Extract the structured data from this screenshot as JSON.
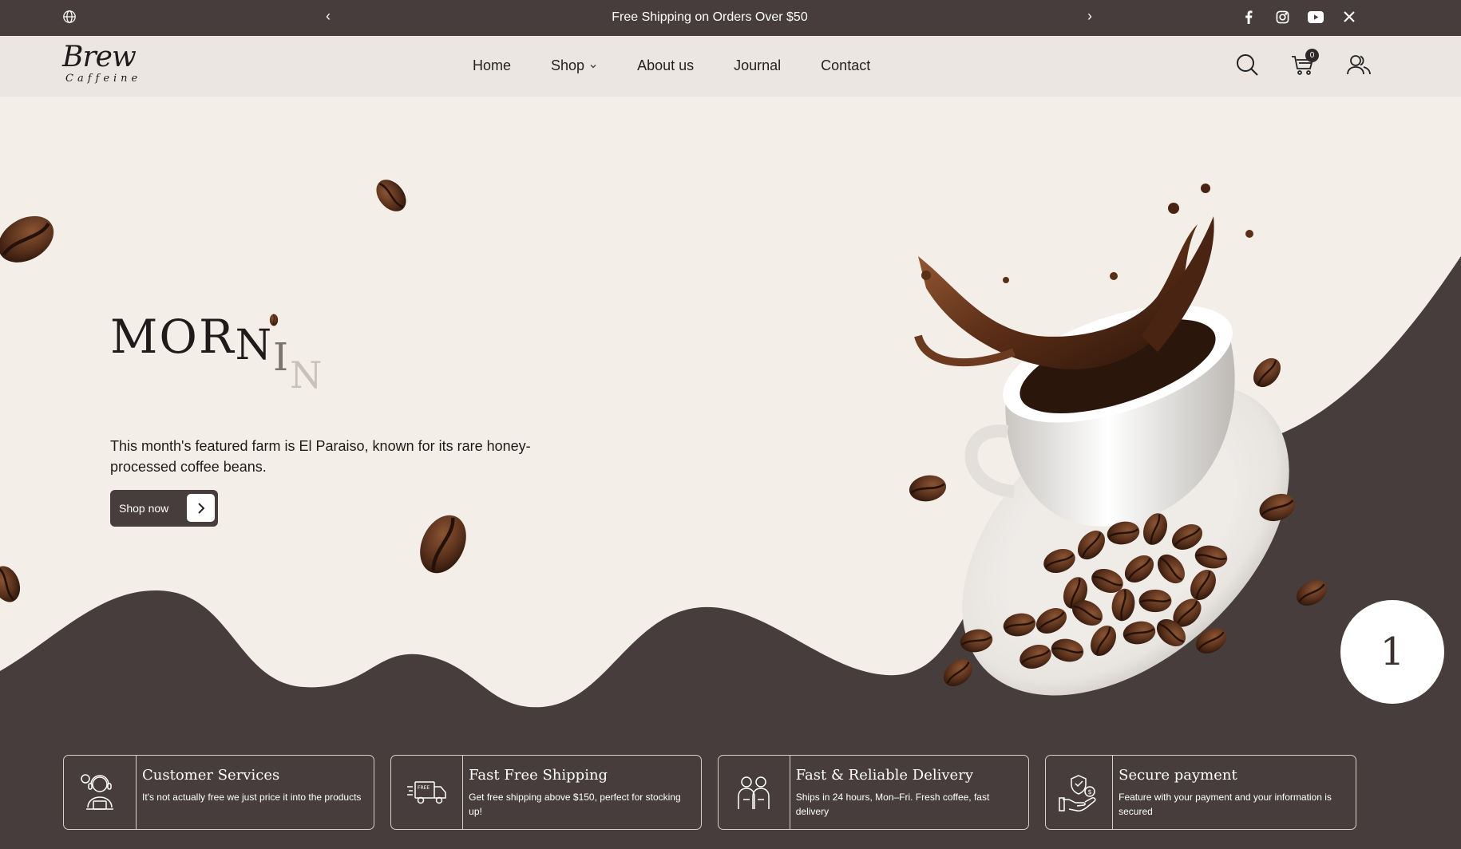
{
  "topbar": {
    "announcement": "Free Shipping on Orders Over $50",
    "prev_label": "‹",
    "next_label": "›",
    "socials": [
      "facebook-icon",
      "instagram-icon",
      "youtube-icon",
      "x-icon"
    ]
  },
  "header": {
    "logo_main": "Brew",
    "logo_sub": "Caffeine",
    "nav": [
      "Home",
      "Shop",
      "About us",
      "Journal",
      "Contact"
    ],
    "cart_count": "0"
  },
  "hero": {
    "title_parts": [
      "MOR",
      "N",
      "I",
      "N"
    ],
    "description": "This month's featured farm is El Paraiso, known for its rare honey-processed coffee beans.",
    "cta_label": "Shop now",
    "slide_number": "1"
  },
  "features": [
    {
      "title": "Customer Services",
      "desc": "It's not actually free we just price it into the products",
      "icon": "customer-service-icon"
    },
    {
      "title": "Fast Free Shipping",
      "desc": "Get free shipping above $150, perfect for stocking up!",
      "icon": "free-truck-icon"
    },
    {
      "title": "Fast & Reliable Delivery",
      "desc": "Ships in 24 hours, Mon–Fri. Fresh coffee, fast delivery",
      "icon": "delivery-people-icon"
    },
    {
      "title": "Secure payment",
      "desc": "Feature with your payment and your information is secured",
      "icon": "secure-payment-icon"
    }
  ],
  "colors": {
    "dark": "#463d3c",
    "cream": "#f3eee8",
    "header": "#ebe6e2"
  }
}
